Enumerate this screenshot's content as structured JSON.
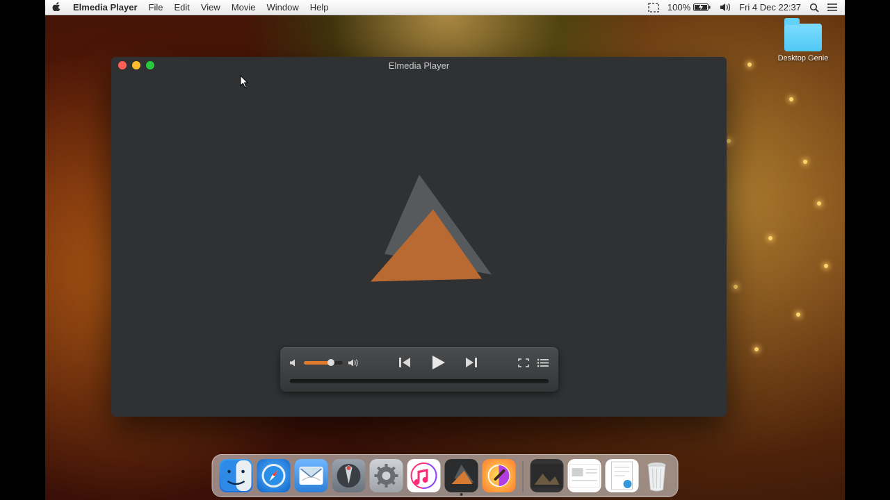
{
  "menubar": {
    "app_name": "Elmedia Player",
    "items": [
      "File",
      "Edit",
      "View",
      "Movie",
      "Window",
      "Help"
    ],
    "battery_percent": "100%",
    "datetime": "Fri 4 Dec  22:37"
  },
  "desktop": {
    "icon_label": "Desktop Genie"
  },
  "window": {
    "title": "Elmedia Player"
  },
  "player": {
    "volume_percent": 70,
    "progress_percent": 0
  },
  "dock": {
    "apps": [
      "finder",
      "safari",
      "mail",
      "launchpad",
      "system-preferences",
      "itunes",
      "elmedia",
      "colorsync"
    ],
    "docs": [
      "image",
      "contacts-card",
      "document"
    ],
    "trash": "trash"
  },
  "colors": {
    "accent": "#e07b2e",
    "window_bg": "#2f3133",
    "control_panel": "#3f4143"
  }
}
